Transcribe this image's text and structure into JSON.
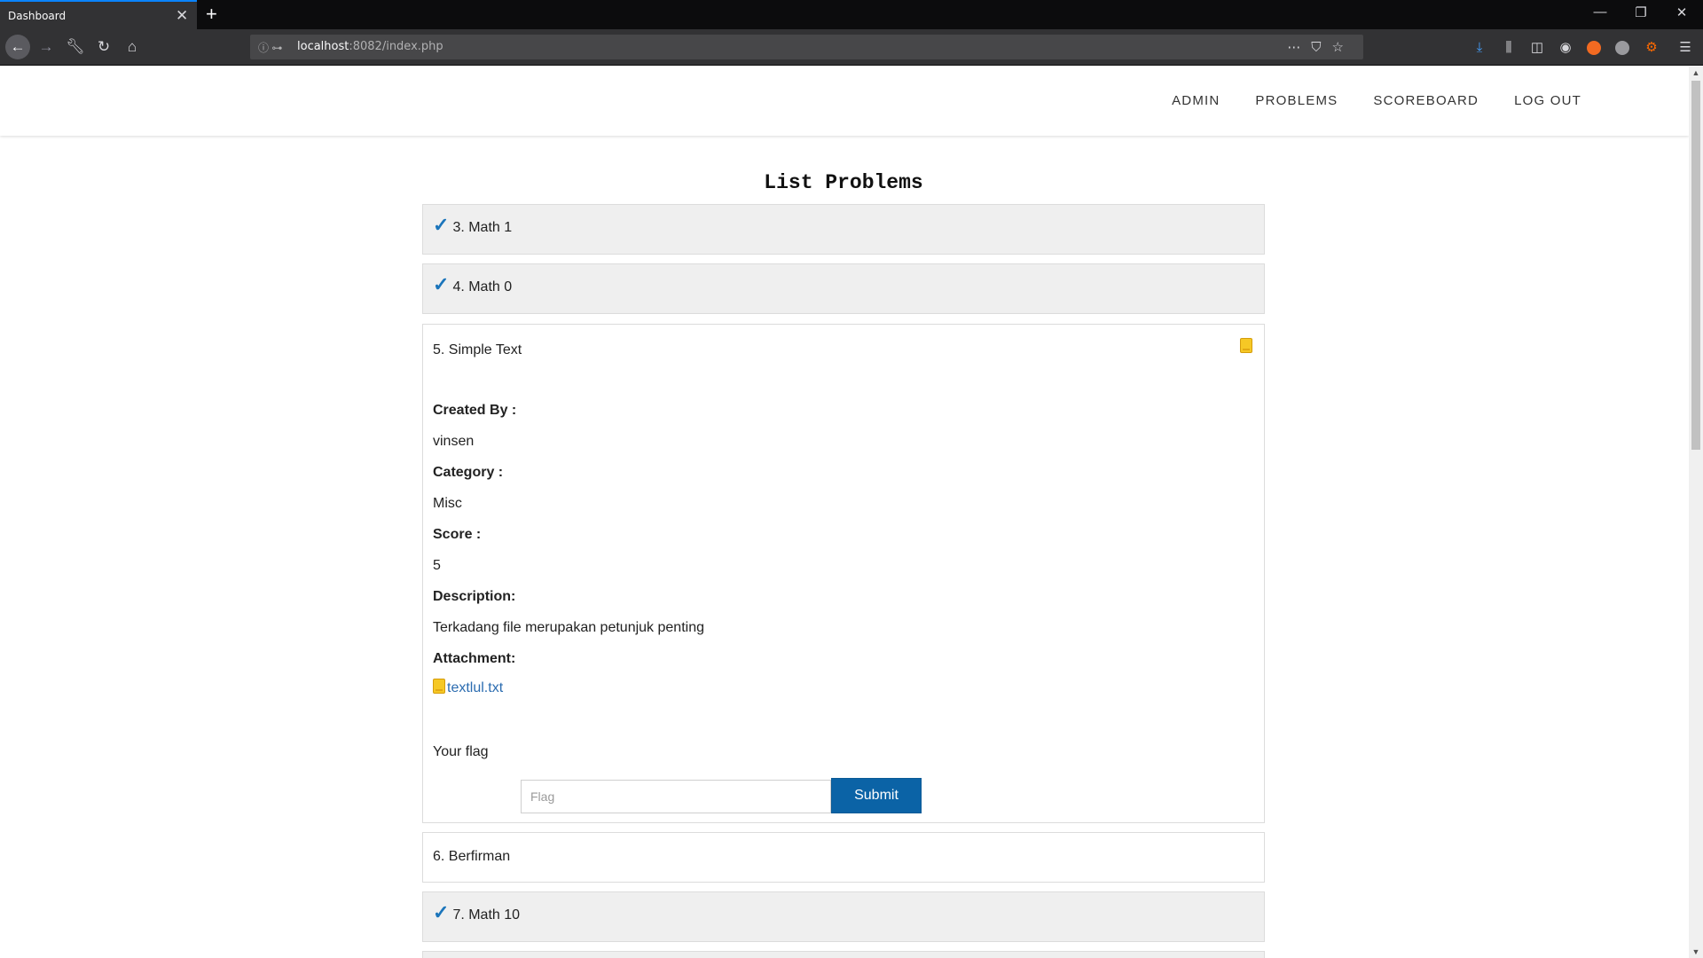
{
  "browser": {
    "tab_title": "Dashboard",
    "tab_close": "✕",
    "new_tab": "+",
    "url_host": "localhost",
    "url_rest": ":8082/index.php",
    "window_controls": [
      "—",
      "❐",
      "✕"
    ]
  },
  "header": {
    "nav": [
      "ADMIN",
      "PROBLEMS",
      "SCOREBOARD",
      "LOG OUT"
    ]
  },
  "page_title": "List Problems",
  "problems": [
    {
      "title": "3. Math 1",
      "solved": true
    },
    {
      "title": "4. Math 0",
      "solved": true
    },
    {
      "title": "5. Simple Text",
      "solved": false,
      "created_by_label": "Created By :",
      "created_by": "vinsen",
      "category_label": "Category :",
      "category": "Misc",
      "score_label": "Score :",
      "score": "5",
      "description_label": "Description:",
      "description": "Terkadang file merupakan petunjuk penting",
      "attachment_label": "Attachment:",
      "attachment": "textlul.txt",
      "flag_label": "Your flag",
      "flag_placeholder": "Flag",
      "submit_label": "Submit"
    },
    {
      "title": "6. Berfirman",
      "solved": false
    },
    {
      "title": "7. Math 10",
      "solved": true
    }
  ],
  "colors": {
    "accent": "#0b63a6",
    "check": "#1b75bb",
    "solved_bg": "#efefef"
  }
}
